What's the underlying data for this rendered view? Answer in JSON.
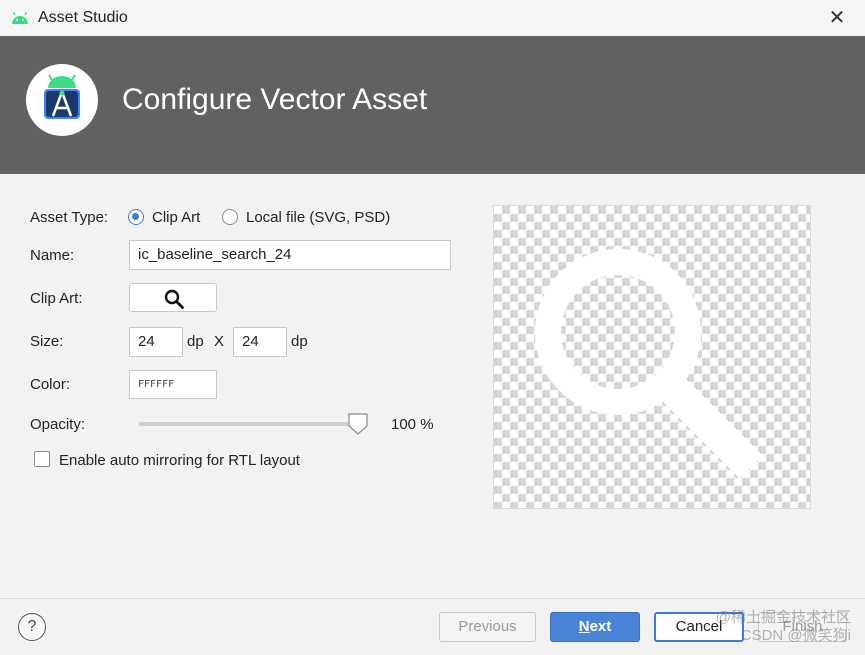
{
  "window": {
    "title": "Asset Studio",
    "close_glyph": "✕"
  },
  "banner": {
    "heading": "Configure Vector Asset"
  },
  "form": {
    "asset_type_label": "Asset Type:",
    "asset_type_options": [
      {
        "label": "Clip Art",
        "selected": true
      },
      {
        "label": "Local file (SVG, PSD)",
        "selected": false
      }
    ],
    "name_label": "Name:",
    "name_value": "ic_baseline_search_24",
    "clip_art_label": "Clip Art:",
    "clip_art_icon": "search-icon",
    "size_label": "Size:",
    "width_value": "24",
    "height_value": "24",
    "dp_unit": "dp",
    "x_separator": "X",
    "color_label": "Color:",
    "color_value": "FFFFFF",
    "opacity_label": "Opacity:",
    "opacity_fraction": 1.0,
    "opacity_text": "100 %",
    "rtl_checkbox_label": "Enable auto mirroring for RTL layout",
    "rtl_checked": false
  },
  "preview": {
    "icon": "search-icon",
    "icon_color": "#FFFFFF"
  },
  "footer": {
    "help_glyph": "?",
    "previous_label": "Previous",
    "next_label_u": "N",
    "next_label_rest": "ext",
    "cancel_label": "Cancel",
    "finish_label": "Finish"
  },
  "watermark": {
    "line1": "@稀土掘金技术社区",
    "line2": "CSDN @微笑狗i"
  },
  "colors": {
    "banner": "#616161",
    "accent": "#3D7BD6",
    "next_button": "#4A84D8"
  }
}
